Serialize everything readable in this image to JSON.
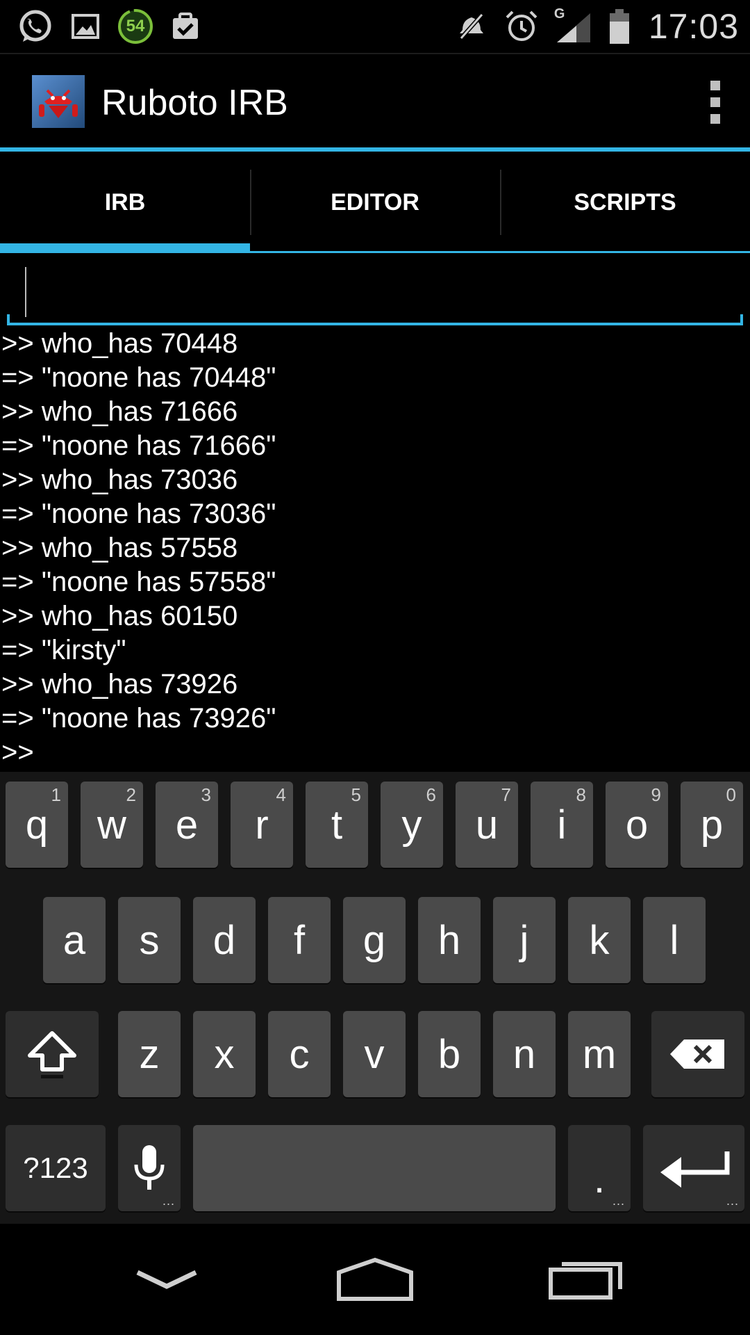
{
  "status_bar": {
    "time": "17:03",
    "battery_level_badge": "54",
    "network_type": "G",
    "left_icons": [
      "whatsapp-icon",
      "gallery-icon",
      "battery-status-icon",
      "clipboard-check-icon"
    ],
    "right_icons": [
      "mute-icon",
      "alarm-icon",
      "signal-icon",
      "battery-icon"
    ]
  },
  "action_bar": {
    "title": "Ruboto IRB",
    "accent_color": "#33b5e5"
  },
  "tabs": [
    {
      "label": "IRB",
      "active": true
    },
    {
      "label": "EDITOR",
      "active": false
    },
    {
      "label": "SCRIPTS",
      "active": false
    }
  ],
  "input": {
    "value": "",
    "placeholder": ""
  },
  "console": {
    "lines": [
      ">> who_has 70448",
      "=> \"noone has 70448\"",
      ">> who_has 71666",
      "=> \"noone has 71666\"",
      ">> who_has 73036",
      "=> \"noone has 73036\"",
      ">> who_has 57558",
      "=> \"noone has 57558\"",
      ">> who_has 60150",
      "=> \"kirsty\"",
      ">> who_has 73926",
      "=> \"noone has 73926\"",
      ">>"
    ]
  },
  "keyboard": {
    "row1": [
      {
        "label": "q",
        "hint": "1"
      },
      {
        "label": "w",
        "hint": "2"
      },
      {
        "label": "e",
        "hint": "3"
      },
      {
        "label": "r",
        "hint": "4"
      },
      {
        "label": "t",
        "hint": "5"
      },
      {
        "label": "y",
        "hint": "6"
      },
      {
        "label": "u",
        "hint": "7"
      },
      {
        "label": "i",
        "hint": "8"
      },
      {
        "label": "o",
        "hint": "9"
      },
      {
        "label": "p",
        "hint": "0"
      }
    ],
    "row2": [
      "a",
      "s",
      "d",
      "f",
      "g",
      "h",
      "j",
      "k",
      "l"
    ],
    "row3": [
      "z",
      "x",
      "c",
      "v",
      "b",
      "n",
      "m"
    ],
    "symbols_label": "?123",
    "period_label": ".",
    "more_indicator": "..."
  },
  "nav_bar": {
    "icons": [
      "back-icon",
      "home-icon",
      "recent-apps-icon"
    ]
  }
}
